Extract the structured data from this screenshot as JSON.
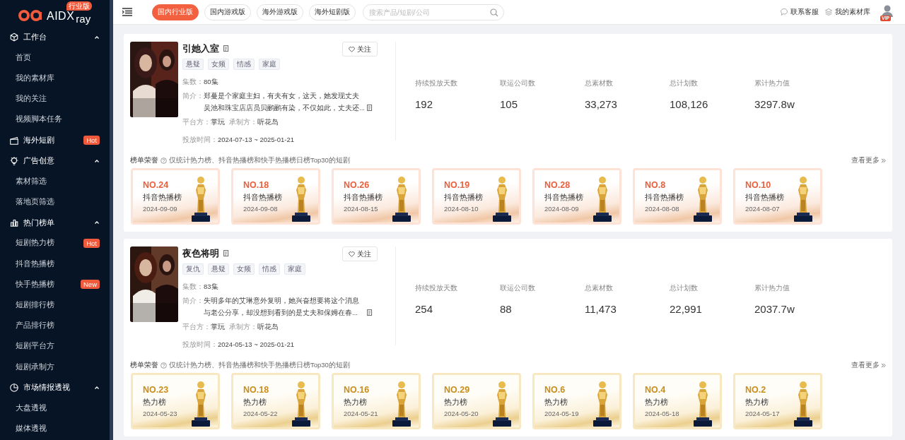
{
  "sidebar": {
    "brand": "AIDX",
    "brand_suffix": "ray",
    "edition": "行业版",
    "nav": [
      {
        "kind": "group",
        "label": "工作台",
        "expanded": true,
        "children": [
          {
            "label": "首页"
          },
          {
            "label": "我的素材库"
          },
          {
            "label": "我的关注"
          },
          {
            "label": "视频脚本任务"
          }
        ]
      },
      {
        "kind": "link",
        "label": "海外短剧",
        "badge": "Hot"
      },
      {
        "kind": "group",
        "label": "广告创意",
        "expanded": true,
        "children": [
          {
            "label": "素材筛选"
          },
          {
            "label": "落地页筛选"
          }
        ]
      },
      {
        "kind": "group",
        "label": "热门榜单",
        "expanded": true,
        "children": [
          {
            "label": "短剧热力榜",
            "badge": "Hot"
          },
          {
            "label": "抖音热播榜"
          },
          {
            "label": "快手热播榜",
            "badge": "New"
          },
          {
            "label": "短剧排行榜"
          },
          {
            "label": "产品排行榜"
          },
          {
            "label": "短剧平台方"
          },
          {
            "label": "短剧承制方"
          }
        ]
      },
      {
        "kind": "group",
        "label": "市场情报透视",
        "expanded": true,
        "children": [
          {
            "label": "大盘透视"
          },
          {
            "label": "媒体透视"
          }
        ]
      }
    ]
  },
  "topbar": {
    "tabs": [
      {
        "label": "国内行业版",
        "selected": true
      },
      {
        "label": "国内游戏版",
        "selected": false
      },
      {
        "label": "海外游戏版",
        "selected": false
      },
      {
        "label": "海外短剧版",
        "selected": false
      }
    ],
    "search": {
      "placeholder": "搜索产品/短剧/公司"
    },
    "links": [
      {
        "label": "联系客服"
      },
      {
        "label": "我的素材库"
      }
    ],
    "avatar_badge": "VIP"
  },
  "dramas": [
    {
      "title": "引她入室",
      "follow": "关注",
      "tags": [
        "悬疑",
        "女频",
        "情感",
        "家庭"
      ],
      "episodes": {
        "label": "集数：",
        "value": "80集"
      },
      "synopsis": {
        "label": "简介：",
        "value": "郑蔓是个家庭主妇，有夫有女，这天，她发现丈夫吴池和珠宝店店员贝鹂鹂有染，不仅如此，丈夫还..."
      },
      "platform": {
        "label": "平台方：",
        "value": "掌玩"
      },
      "producer": {
        "label": "承制方：",
        "value": "听花岛"
      },
      "period": {
        "label": "投放时间：",
        "value": "2024-07-13 ~ 2025-01-21"
      },
      "stats": [
        {
          "label": "持续投放天数",
          "value": "192"
        },
        {
          "label": "联运公司数",
          "value": "105"
        },
        {
          "label": "总素材数",
          "value": "33,273"
        },
        {
          "label": "总计划数",
          "value": "108,126"
        },
        {
          "label": "累计热力值",
          "value": "3297.8w"
        }
      ],
      "honors": {
        "title": "榜单荣誉",
        "note": "仅统计热力榜、抖音热播榜和快手热播榜日榜Top30的短剧",
        "more": "查看更多",
        "awards": [
          {
            "kind": "peach",
            "rank": "NO.24",
            "list": "抖音热播榜",
            "date": "2024-09-09"
          },
          {
            "kind": "peach",
            "rank": "NO.18",
            "list": "抖音热播榜",
            "date": "2024-09-08"
          },
          {
            "kind": "peach",
            "rank": "NO.26",
            "list": "抖音热播榜",
            "date": "2024-08-15"
          },
          {
            "kind": "peach",
            "rank": "NO.19",
            "list": "抖音热播榜",
            "date": "2024-08-10"
          },
          {
            "kind": "peach",
            "rank": "NO.28",
            "list": "抖音热播榜",
            "date": "2024-08-09"
          },
          {
            "kind": "peach",
            "rank": "NO.8",
            "list": "抖音热播榜",
            "date": "2024-08-08"
          },
          {
            "kind": "peach",
            "rank": "NO.10",
            "list": "抖音热播榜",
            "date": "2024-08-07"
          }
        ]
      }
    },
    {
      "title": "夜色将明",
      "follow": "关注",
      "tags": [
        "复仇",
        "悬疑",
        "女频",
        "情感",
        "家庭"
      ],
      "episodes": {
        "label": "集数：",
        "value": "83集"
      },
      "synopsis": {
        "label": "简介：",
        "value": "失明多年的艾琳意外复明，她兴奋想要将这个消息与老公分享，却没想到看到的是丈夫和保姆在春..."
      },
      "platform": {
        "label": "平台方：",
        "value": "掌玩"
      },
      "producer": {
        "label": "承制方：",
        "value": "听花岛"
      },
      "period": {
        "label": "投放时间：",
        "value": "2024-05-13 ~ 2025-01-21"
      },
      "stats": [
        {
          "label": "持续投放天数",
          "value": "254"
        },
        {
          "label": "联运公司数",
          "value": "88"
        },
        {
          "label": "总素材数",
          "value": "11,473"
        },
        {
          "label": "总计划数",
          "value": "22,991"
        },
        {
          "label": "累计热力值",
          "value": "2037.7w"
        }
      ],
      "honors": {
        "title": "榜单荣誉",
        "note": "仅统计热力榜、抖音热播榜和快手热播榜日榜Top30的短剧",
        "more": "查看更多",
        "awards": [
          {
            "kind": "gold",
            "rank": "NO.23",
            "list": "热力榜",
            "date": "2024-05-23"
          },
          {
            "kind": "gold",
            "rank": "NO.18",
            "list": "热力榜",
            "date": "2024-05-22"
          },
          {
            "kind": "gold",
            "rank": "NO.16",
            "list": "热力榜",
            "date": "2024-05-21"
          },
          {
            "kind": "gold",
            "rank": "NO.29",
            "list": "热力榜",
            "date": "2024-05-20"
          },
          {
            "kind": "gold",
            "rank": "NO.6",
            "list": "热力榜",
            "date": "2024-05-19"
          },
          {
            "kind": "gold",
            "rank": "NO.4",
            "list": "热力榜",
            "date": "2024-05-18"
          },
          {
            "kind": "gold",
            "rank": "NO.2",
            "list": "热力榜",
            "date": "2024-05-17"
          }
        ]
      }
    }
  ]
}
